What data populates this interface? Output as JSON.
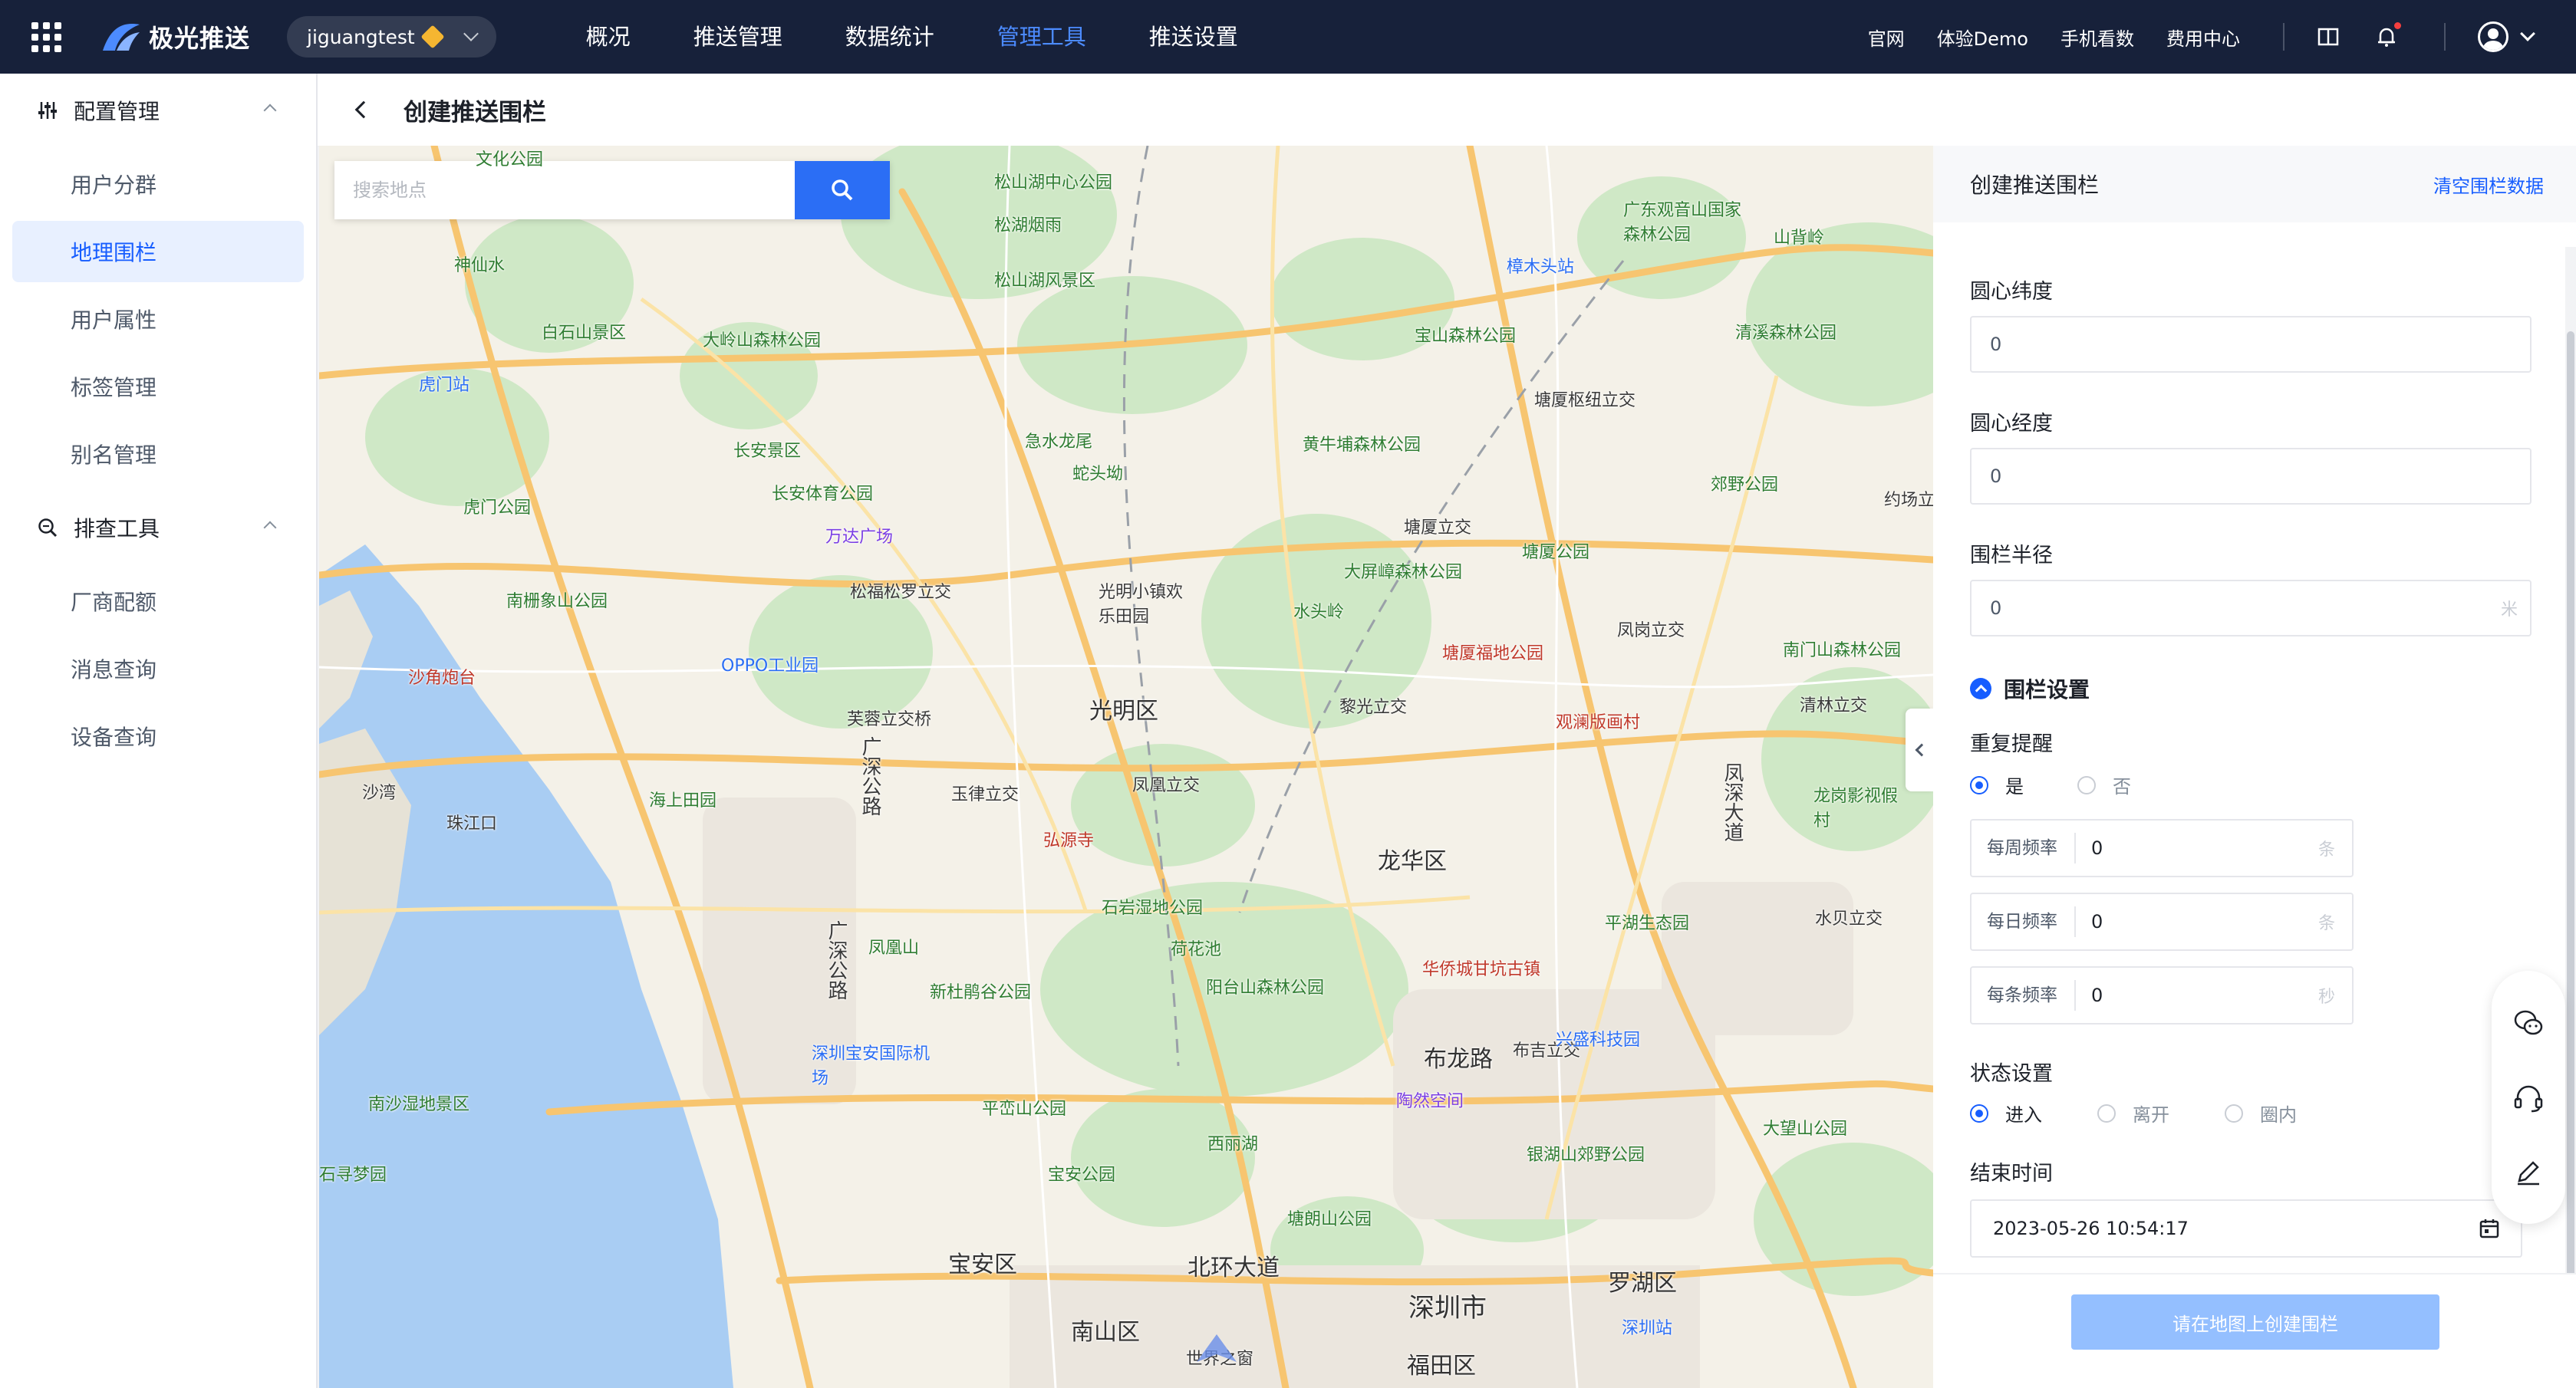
{
  "topnav": {
    "brand": "极光推送",
    "account": "jiguangtest",
    "menu": [
      "概况",
      "推送管理",
      "数据统计",
      "管理工具",
      "推送设置"
    ],
    "active_menu": "管理工具",
    "links": [
      "官网",
      "体验Demo",
      "手机看数",
      "费用中心"
    ]
  },
  "sidebar": {
    "groups": [
      {
        "label": "配置管理",
        "icon": "sliders-icon",
        "items": [
          "用户分群",
          "地理围栏",
          "用户属性",
          "标签管理",
          "别名管理"
        ]
      },
      {
        "label": "排查工具",
        "icon": "search-zoom-icon",
        "items": [
          "厂商配额",
          "消息查询",
          "设备查询"
        ]
      }
    ],
    "active_item": "地理围栏"
  },
  "page": {
    "title": "创建推送围栏"
  },
  "map": {
    "search_placeholder": "搜索地点",
    "labels": {
      "guangming": "光明区",
      "longhua": "龙华区",
      "baoan": "宝安区",
      "nanshan": "南山区",
      "futian": "福田区",
      "luohu": "罗湖区",
      "shenzhen": "深圳市",
      "buji": "布龙路",
      "songshan": "松山湖中心公园",
      "songhu": "松湖烟雨",
      "songshanfj": "松山湖风景区",
      "baishishan": "白石山景区",
      "daling": "大岭山森林公园",
      "humen": "虎门站",
      "changan": "长安景区",
      "changanty": "长安体育公园",
      "humengy": "虎门公园",
      "wanda": "万达广场",
      "songfu": "松福松罗立交",
      "guangmingxz": "光明小镇欢乐田园",
      "jishui": "急水龙尾",
      "shetou": "蛇头坳",
      "huangniu": "黄牛埔森林公园",
      "baoshan": "宝山森林公园",
      "tanghuang": "塘厦立交",
      "tangsha": "塘厦公园",
      "dapingzhang": "大屏嶂森林公园",
      "shuitou": "水头岭",
      "tanglang": "塘厦福地公园",
      "guanlan": "观澜版画村",
      "lihua": "黎光立交",
      "fenghuang": "凤凰立交",
      "yujin": "玉律立交",
      "hongyuan": "弘源寺",
      "shiyan": "石岩湿地公园",
      "hehua": "荷花池",
      "yangtai": "阳台山森林公园",
      "xinhe": "新杜鹃谷公园",
      "fenghuangshan": "凤凰山",
      "airport": "深圳宝安国际机场",
      "pingluo": "平峦山公园",
      "xili": "西丽湖",
      "baoan_park": "宝安公园",
      "tangling": "塘朗山公园",
      "beihuan": "北环大道",
      "window": "世界之窗",
      "shenzhenzhan": "深圳站",
      "yinhu": "银湖山郊野公园",
      "pinghu": "平湖生态园",
      "huaqiao": "华侨城甘坑古镇",
      "bujizi": "布吉立交",
      "dawangshan": "大望山公园",
      "qingxi": "清溪森林公园",
      "guanyin": "广东观音山国家森林公园",
      "zhangmu": "樟木头站",
      "shanbei": "山背岭",
      "fengshan": "凤岗立交",
      "jiaoye": "郊野公园",
      "nanmen": "南门山森林公园",
      "qinglin": "清林立交",
      "longgang": "龙岗影视假村",
      "shuijing": "水贝立交",
      "nanshami": "南沙湿地景区",
      "shajiao": "沙角炮台",
      "zhoushan": "南栅象山公园",
      "oppo": "OPPO工业园",
      "furong": "芙蓉立交桥",
      "haishang": "海上田园",
      "guangshen1": "广深公路",
      "guangshen2": "广深公路",
      "fenggang": "凤深大道",
      "zhujiang": "珠江口",
      "shawan": "沙湾",
      "yangtaishan": "文化公园",
      "shuitang": "塘厦枢纽立交",
      "yuezhao": "约场立交",
      "xiangang": "兴盛科技园",
      "jiaopeng": "陶然空间",
      "xingfu": "石寻梦园",
      "ruiyun": "神仙水"
    }
  },
  "panel": {
    "title": "创建推送围栏",
    "clear": "清空围栏数据",
    "lat_label": "圆心纬度",
    "lat_value": "0",
    "lng_label": "圆心经度",
    "lng_value": "0",
    "radius_label": "围栏半径",
    "radius_value": "0",
    "radius_unit": "米",
    "fence_settings": "围栏设置",
    "repeat_label": "重复提醒",
    "repeat_options": [
      "是",
      "否"
    ],
    "repeat_selected": "是",
    "freq": [
      {
        "key": "每周频率",
        "value": "0",
        "unit": "条"
      },
      {
        "key": "每日频率",
        "value": "0",
        "unit": "条"
      },
      {
        "key": "每条频率",
        "value": "0",
        "unit": "秒"
      }
    ],
    "status_label": "状态设置",
    "status_options": [
      "进入",
      "离开",
      "圈内"
    ],
    "status_selected": "进入",
    "end_label": "结束时间",
    "end_value": "2023-05-26 10:54:17",
    "submit": "请在地图上创建围栏"
  },
  "colors": {
    "nav_bg": "#17213a",
    "accent": "#165dff",
    "active_menu": "#4c8bff",
    "submit_disabled": "#94bfff"
  }
}
